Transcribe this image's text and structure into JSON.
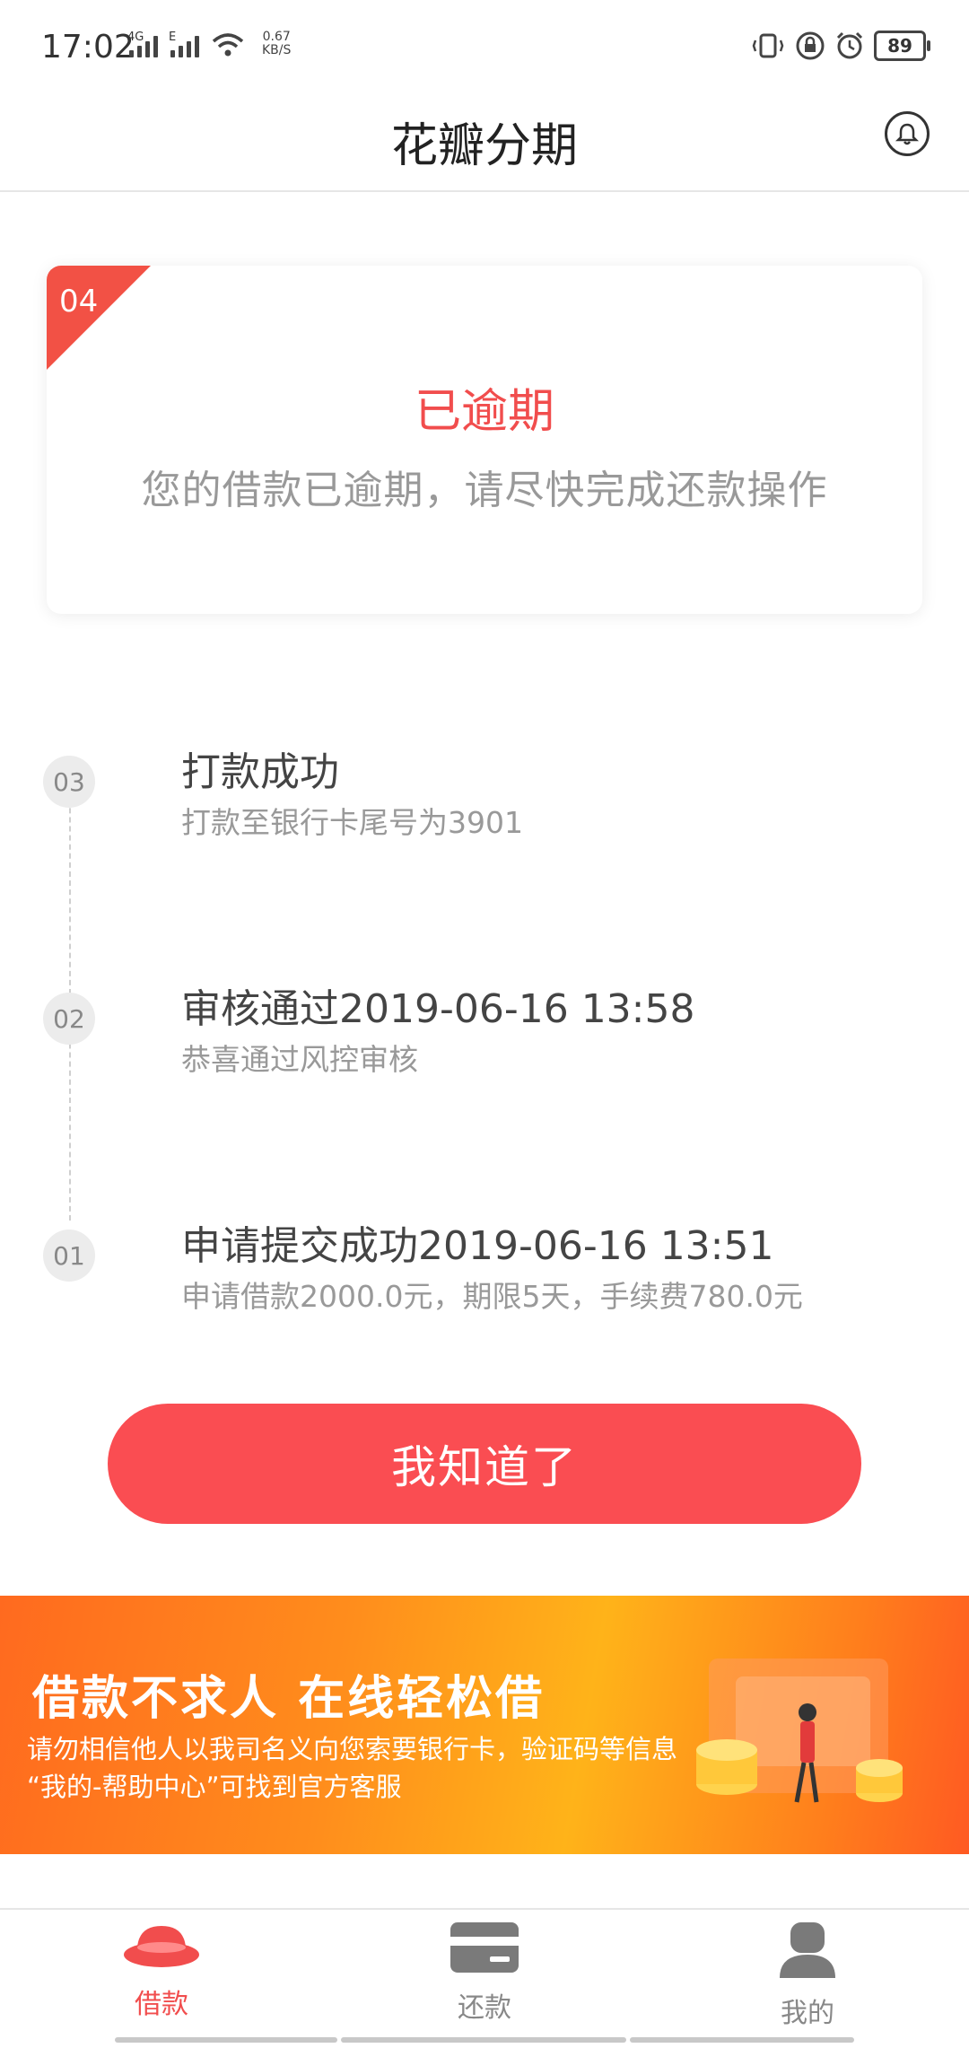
{
  "status_bar": {
    "time": "17:02",
    "network_1": "4G",
    "network_2": "E",
    "speed_value": "0.67",
    "speed_unit": "KB/S",
    "battery": "89",
    "icons": [
      "vibrate-icon",
      "rotation-lock-icon",
      "alarm-icon"
    ]
  },
  "header": {
    "title": "花瓣分期",
    "right_icon": "bell-icon"
  },
  "status_card": {
    "step_number": "04",
    "title": "已逾期",
    "description": "您的借款已逾期，请尽快完成还款操作",
    "accent_color": "#f14d4d"
  },
  "timeline": [
    {
      "step": "03",
      "title": "打款成功",
      "subtitle": "打款至银行卡尾号为3901"
    },
    {
      "step": "02",
      "title": "审核通过2019-06-16 13:58",
      "subtitle": "恭喜通过风控审核"
    },
    {
      "step": "01",
      "title": "申请提交成功2019-06-16 13:51",
      "subtitle": "申请借款2000.0元，期限5天，手续费780.0元"
    }
  ],
  "confirm_button": {
    "label": "我知道了",
    "color": "#fa4d52"
  },
  "banner": {
    "headline": "借款不求人 在线轻松借",
    "line1": "请勿相信他人以我司名义向您索要银行卡，验证码等信息",
    "line2": "“我的-帮助中心”可找到官方客服"
  },
  "tabbar": {
    "items": [
      {
        "label": "借款",
        "icon": "ingot-icon",
        "active": true
      },
      {
        "label": "还款",
        "icon": "card-icon",
        "active": false
      },
      {
        "label": "我的",
        "icon": "user-icon",
        "active": false
      }
    ],
    "active_color": "#f14d4d"
  }
}
